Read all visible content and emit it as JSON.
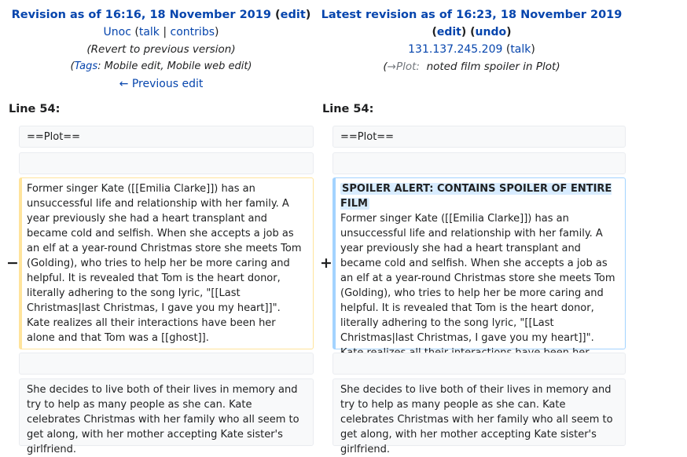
{
  "left": {
    "title": "Revision as of 16:16, 18 November 2019",
    "edit": "edit",
    "user": "Unoc",
    "talk": "talk",
    "contribs": "contribs",
    "summary": "(Revert to previous version)",
    "tags_label": "Tags",
    "tags_value": "Mobile edit, Mobile web edit",
    "prev_edit": "← Previous edit",
    "line_label": "Line 54:",
    "marker": "−"
  },
  "right": {
    "title": "Latest revision as of 16:23, 18 November 2019",
    "edit": "edit",
    "undo": "undo",
    "user": "131.137.245.209",
    "talk": "talk",
    "comment_section": "→Plot:",
    "comment_text": "noted film spoiler in Plot",
    "line_label": "Line 54:",
    "marker": "+",
    "spoiler": "SPOILER ALERT: CONTAINS SPOILER OF ENTIRE FILM"
  },
  "diff": {
    "heading": "==Plot==",
    "changed_paragraph": "Former singer Kate ([[Emilia Clarke]]) has an unsuccessful life and relationship with her family. A year previously she had a heart transplant and became cold and selfish. When she accepts a job as an elf at a year-round Christmas store she meets Tom (Golding), who tries to help her be more caring and helpful. It is revealed that Tom is the heart donor, literally adhering to the song lyric, \"[[Last Christmas|last Christmas, I gave you my heart]]\". Kate realizes all their interactions have been her alone and that Tom was a [[ghost]].",
    "context_paragraph": "She decides to live both of their lives in memory and try to help as many people as she can. Kate celebrates Christmas with her family who all seem to get along, with her mother accepting Kate sister's girlfriend."
  },
  "colors": {
    "link": "#0645ad",
    "deleted_border": "#ffe49c",
    "added_border": "#a3d3ff",
    "context_bg": "#f8f9fa"
  }
}
